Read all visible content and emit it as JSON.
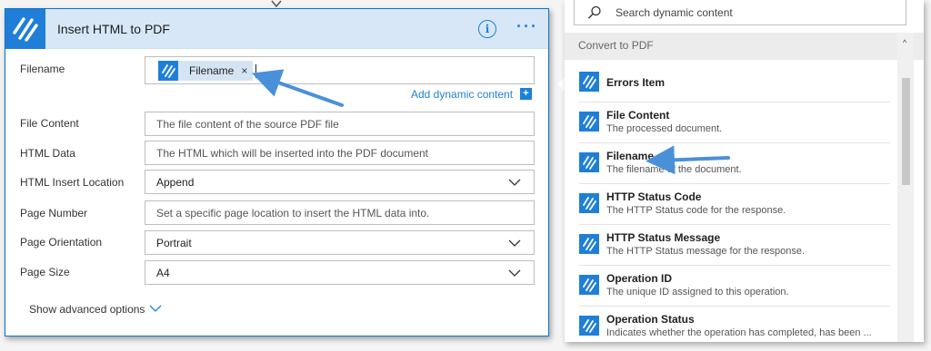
{
  "card": {
    "title": "Insert HTML to PDF",
    "info_icon": "info-icon",
    "more_icon": "more-icon",
    "more_label": "···",
    "fields": [
      {
        "label": "Filename",
        "type": "token",
        "token": "Filename",
        "token_close": "×"
      },
      {
        "label": "File Content",
        "type": "text",
        "placeholder": "The file content of the source PDF file"
      },
      {
        "label": "HTML Data",
        "type": "text",
        "placeholder": "The HTML which will be inserted into the PDF document"
      },
      {
        "label": "HTML Insert Location",
        "type": "select",
        "value": "Append"
      },
      {
        "label": "Page Number",
        "type": "text",
        "placeholder": "Set a specific page location to insert the HTML data into."
      },
      {
        "label": "Page Orientation",
        "type": "select",
        "value": "Portrait"
      },
      {
        "label": "Page Size",
        "type": "select",
        "value": "A4"
      }
    ],
    "add_dynamic_content": "Add dynamic content",
    "add_dynamic_icon": "+",
    "show_advanced": "Show advanced options"
  },
  "panel": {
    "search_placeholder": "Search dynamic content",
    "section_title": "Convert to PDF",
    "scroll_up": "^",
    "items": [
      {
        "title": "Errors Item",
        "desc": ""
      },
      {
        "title": "File Content",
        "desc": "The processed document."
      },
      {
        "title": "Filename",
        "desc": "The filename of the document."
      },
      {
        "title": "HTTP Status Code",
        "desc": "The HTTP Status code for the response."
      },
      {
        "title": "HTTP Status Message",
        "desc": "The HTTP Status message for the response."
      },
      {
        "title": "Operation ID",
        "desc": "The unique ID assigned to this operation."
      },
      {
        "title": "Operation Status",
        "desc": "Indicates whether the operation has completed, has been ..."
      }
    ]
  },
  "colors": {
    "accent": "#1f7fd8",
    "header_bg": "#d7e7f7",
    "annotation_arrow": "#4a90d9"
  }
}
